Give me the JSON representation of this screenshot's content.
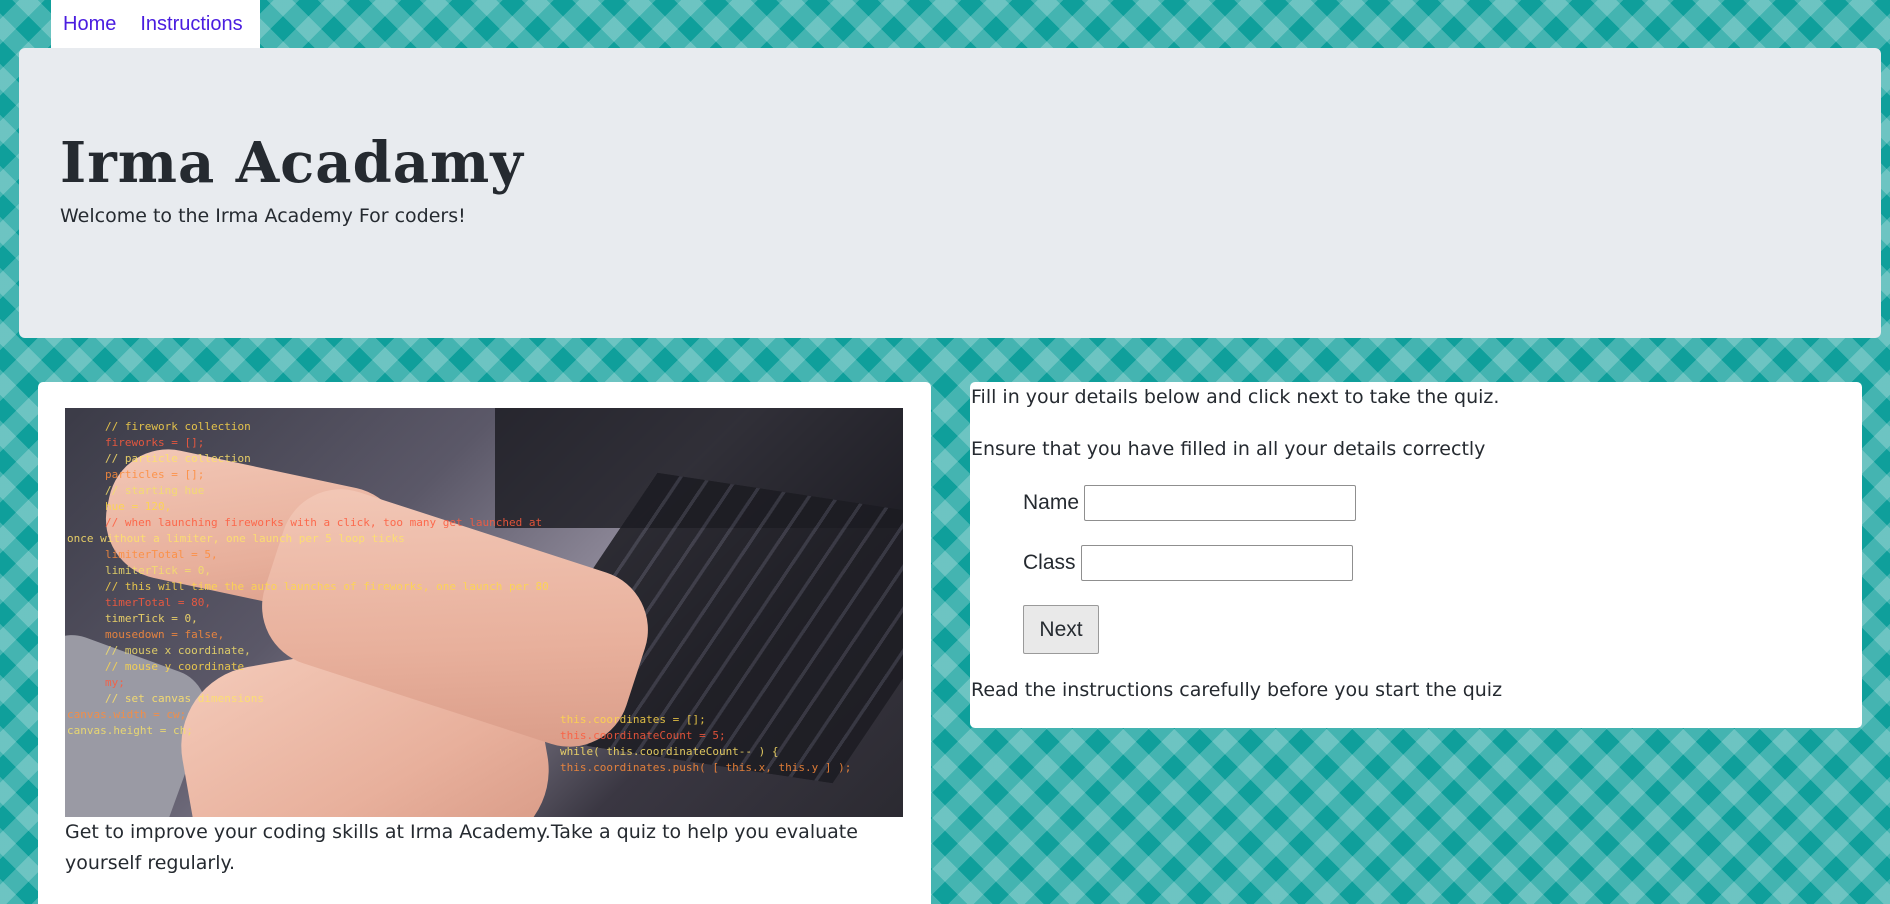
{
  "nav": {
    "home": "Home",
    "instructions": "Instructions"
  },
  "hero": {
    "title": "Irma Acadamy",
    "subtitle": "Welcome to the Irma Academy For coders!"
  },
  "left_card": {
    "caption": "Get to improve your coding skills at Irma Academy.Take a quiz to help you evaluate yourself regularly.",
    "photo_code_lines": [
      "// firework collection",
      "fireworks = [];",
      "// particle collection",
      "particles = [];",
      "// starting hue",
      "hue = 120,",
      "// when launching fireworks with a click, too many get launched at",
      "once without a limiter, one launch per 5 loop ticks",
      "limiterTotal = 5,",
      "limiterTick = 0,",
      "// this will time the auto launches of fireworks, one launch per 80",
      "timerTotal = 80,",
      "timerTick = 0,",
      "mousedown = false,",
      "// mouse x coordinate,",
      "// mouse y coordinate",
      "my;",
      "// set canvas dimensions",
      "canvas.width = cw;",
      "canvas.height = ch;",
      "this.coordinates = [];",
      "this.coordinateCount = 5;",
      "while( this.coordinateCount-- ) {",
      "this.coordinates.push( [ this.x, this.y ] );"
    ]
  },
  "right_card": {
    "intro": "Fill in your details below and click next to take the quiz.",
    "ensure": "Ensure that you have filled in all your details correctly",
    "name_label": "Name",
    "name_value": "",
    "class_label": "Class",
    "class_value": "",
    "next_label": "Next",
    "footer_note": "Read the instructions carefully before you start the quiz"
  }
}
